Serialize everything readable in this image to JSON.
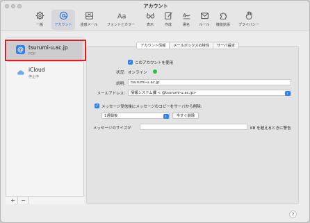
{
  "window": {
    "title": "アカウント"
  },
  "toolbar": [
    {
      "label": "一般",
      "icon": "gear-icon"
    },
    {
      "label": "アカウント",
      "icon": "at-icon",
      "active": true
    },
    {
      "label": "迷惑メール",
      "icon": "junk-tray-icon"
    },
    {
      "label": "フォントとカラー",
      "icon": "font-icon"
    },
    {
      "label": "表示",
      "icon": "glasses-icon"
    },
    {
      "label": "作成",
      "icon": "compose-icon"
    },
    {
      "label": "署名",
      "icon": "signature-icon"
    },
    {
      "label": "ルール",
      "icon": "rules-envelope-icon"
    },
    {
      "label": "機能拡張",
      "icon": "puzzle-icon"
    },
    {
      "label": "プライバシー",
      "icon": "hand-icon"
    }
  ],
  "sidebar": {
    "accounts": [
      {
        "name": "tsurumi-u.ac.jp",
        "sub": "POP",
        "icon": "at-badge-icon",
        "color": "#2f7ff0",
        "selected": true
      },
      {
        "name": "iCloud",
        "sub": "停止中",
        "icon": "cloud-icon",
        "color": "#6fa8e8",
        "selected": false
      }
    ],
    "add": "+",
    "remove": "−"
  },
  "tabs": [
    {
      "label": "アカウント情報",
      "active": true
    },
    {
      "label": "メールボックスの特性",
      "active": false
    },
    {
      "label": "サーバ設定",
      "active": false
    }
  ],
  "form": {
    "enable_label": "このアカウントを使用",
    "status_label": "状況:",
    "status_value": "オンライン",
    "status_color": "#2fbf4a",
    "description_label": "説明:",
    "description_value": "tsurumi-u.ac.jp",
    "email_label": "メールアドレス:",
    "email_value": "情報システム課 <                @tsurumi-u.ac.jp>",
    "remove_copy_label": "メッセージ受信後にメッセージのコピーをサーバから削除:",
    "remove_after_value": "1週間後",
    "remove_now_button": "今すぐ削除",
    "size_label": "メッセージのサイズが",
    "size_value": "",
    "size_suffix": "KB を超えるときに警告"
  },
  "help": "?"
}
